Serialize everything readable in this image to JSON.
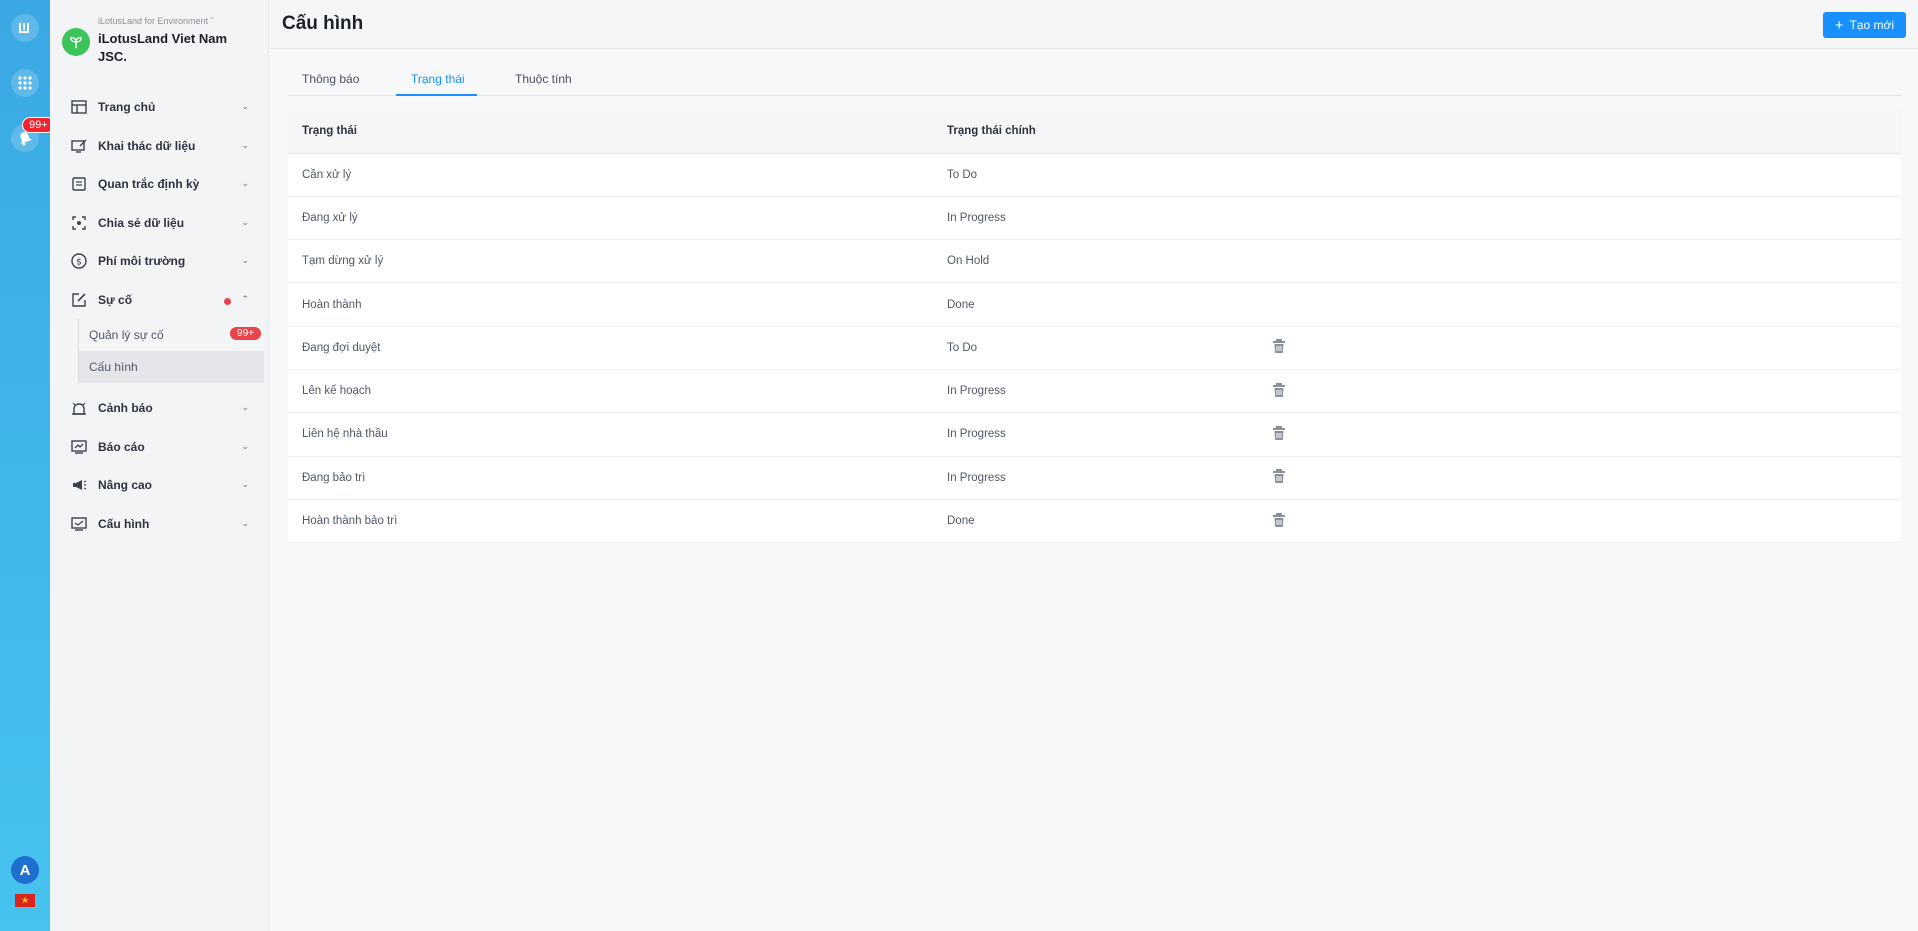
{
  "rail": {
    "badge": "99+",
    "avatar": "A",
    "icons": [
      "apps-logo-icon",
      "grid-icon",
      "bell-icon",
      "vn-flag-icon"
    ]
  },
  "org": {
    "subtitle": "iLotusLand for Environment ˜",
    "name": "iLotusLand Viet Nam JSC."
  },
  "sidebar": {
    "items": [
      {
        "label": "Trang chủ",
        "icon": "layout-icon"
      },
      {
        "label": "Khai thác dữ liệu",
        "icon": "monitor-edit-icon"
      },
      {
        "label": "Quan trắc định kỳ",
        "icon": "document-icon"
      },
      {
        "label": "Chia sẻ dữ liệu",
        "icon": "focus-icon"
      },
      {
        "label": "Phí môi trường",
        "icon": "dollar-icon"
      },
      {
        "label": "Sự cố",
        "icon": "edit-icon"
      },
      {
        "label": "Cảnh báo",
        "icon": "alarm-icon"
      },
      {
        "label": "Báo cáo",
        "icon": "report-icon"
      },
      {
        "label": "Nâng cao",
        "icon": "megaphone-icon"
      },
      {
        "label": "Cấu hình",
        "icon": "config-icon"
      }
    ],
    "subitems": [
      {
        "label": "Quản lý sự cố",
        "badge": "99+"
      },
      {
        "label": "Cấu hình"
      }
    ]
  },
  "header": {
    "title": "Cấu hình",
    "create_label": "Tạo mới"
  },
  "tabs": [
    "Thông báo",
    "Trạng thái",
    "Thuộc tính"
  ],
  "table": {
    "headers": [
      "Trạng thái",
      "Trạng thái chính"
    ],
    "rows": [
      {
        "status": "Cần xử lý",
        "main": "To Do",
        "deletable": false
      },
      {
        "status": "Đang xử lý",
        "main": "In Progress",
        "deletable": false
      },
      {
        "status": "Tạm dừng xử lý",
        "main": "On Hold",
        "deletable": false
      },
      {
        "status": "Hoàn thành",
        "main": "Done",
        "deletable": false
      },
      {
        "status": "Đang đợi duyệt",
        "main": "To Do",
        "deletable": true
      },
      {
        "status": "Lên kế hoạch",
        "main": "In Progress",
        "deletable": true
      },
      {
        "status": "Liên hệ nhà thầu",
        "main": "In Progress",
        "deletable": true
      },
      {
        "status": "Đang bảo trì",
        "main": "In Progress",
        "deletable": true
      },
      {
        "status": "Hoàn thành bảo trì",
        "main": "Done",
        "deletable": true
      }
    ]
  },
  "colors": {
    "accent": "#1890ff",
    "danger": "#e8434a",
    "rail": "#3aa8e3"
  }
}
